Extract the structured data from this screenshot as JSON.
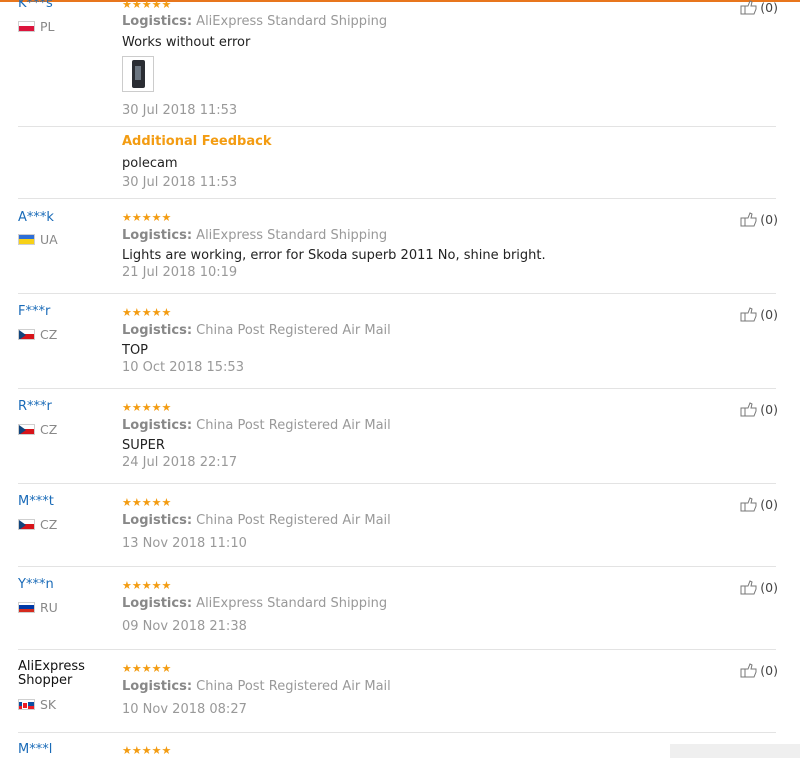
{
  "reviews": [
    {
      "user": "K***s",
      "country": "PL",
      "flag": "pl",
      "stars": "★★★★★",
      "logistics_label": "Logistics:",
      "logistics": "AliExpress Standard Shipping",
      "text": "Works without error",
      "date": "30 Jul 2018 11:53",
      "helpful": "(0)",
      "additional": {
        "label": "Additional Feedback",
        "text": "polecam",
        "date": "30 Jul 2018 11:53"
      }
    },
    {
      "user": "A***k",
      "country": "UA",
      "flag": "ua",
      "stars": "★★★★★",
      "logistics_label": "Logistics:",
      "logistics": "AliExpress Standard Shipping",
      "text": "Lights are working, error for Skoda superb 2011 No, shine bright.",
      "date": "21 Jul 2018 10:19",
      "helpful": "(0)"
    },
    {
      "user": "F***r",
      "country": "CZ",
      "flag": "cz",
      "stars": "★★★★★",
      "logistics_label": "Logistics:",
      "logistics": "China Post Registered Air Mail",
      "text": "TOP",
      "date": "10 Oct 2018 15:53",
      "helpful": "(0)"
    },
    {
      "user": "R***r",
      "country": "CZ",
      "flag": "cz",
      "stars": "★★★★★",
      "logistics_label": "Logistics:",
      "logistics": "China Post Registered Air Mail",
      "text": "SUPER",
      "date": "24 Jul 2018 22:17",
      "helpful": "(0)"
    },
    {
      "user": "M***t",
      "country": "CZ",
      "flag": "cz",
      "stars": "★★★★★",
      "logistics_label": "Logistics:",
      "logistics": "China Post Registered Air Mail",
      "text": "",
      "date": "13 Nov 2018 11:10",
      "helpful": "(0)"
    },
    {
      "user": "Y***n",
      "country": "RU",
      "flag": "ru",
      "stars": "★★★★★",
      "logistics_label": "Logistics:",
      "logistics": "AliExpress Standard Shipping",
      "text": "",
      "date": "09 Nov 2018 21:38",
      "helpful": "(0)"
    },
    {
      "user": "AliExpress Shopper",
      "country": "SK",
      "flag": "sk",
      "stars": "★★★★★",
      "logistics_label": "Logistics:",
      "logistics": "China Post Registered Air Mail",
      "text": "",
      "date": "10 Nov 2018 08:27",
      "helpful": "(0)"
    },
    {
      "user": "M***l",
      "country": "",
      "flag": "",
      "stars": "★★★★★",
      "logistics_label": "",
      "logistics": "",
      "text": "",
      "date": "",
      "helpful": ""
    }
  ],
  "colors": {
    "accent": "#e8761d",
    "star": "#f39c12",
    "link": "#1a6bb8"
  }
}
